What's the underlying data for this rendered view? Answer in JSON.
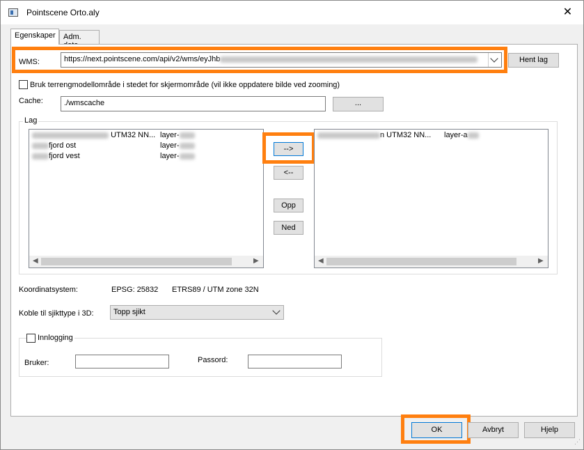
{
  "window": {
    "title": "Pointscene Orto.aly",
    "close_glyph": "✕"
  },
  "tabs": [
    {
      "label": "Egenskaper"
    },
    {
      "label": "Adm. data"
    }
  ],
  "wms": {
    "label": "WMS:",
    "value": "https://next.pointscene.com/api/v2/wms/eyJhb",
    "fetch_button": "Hent lag"
  },
  "terrain_checkbox": {
    "label": "Bruk terrengmodellområde i stedet for skjermområde (vil ikke oppdatere bilde ved zooming)",
    "checked": false
  },
  "cache": {
    "label": "Cache:",
    "value": "./wmscache",
    "browse_button": "..."
  },
  "layers": {
    "group_label": "Lag",
    "available": [
      {
        "name": "UTM32 NN...",
        "id": "layer-"
      },
      {
        "name": "fjord ost",
        "id": "layer-"
      },
      {
        "name": "fjord vest",
        "id": "layer-"
      }
    ],
    "selected": [
      {
        "name": "n  UTM32 NN...",
        "id": "layer-a"
      }
    ],
    "buttons": {
      "add": "-->",
      "remove": "<--",
      "up": "Opp",
      "down": "Ned"
    }
  },
  "coord": {
    "label": "Koordinatsystem:",
    "epsg": "EPSG: 25832",
    "name": "ETRS89 / UTM zone 32N"
  },
  "layer3d": {
    "label": "Koble til sjikttype i 3D:",
    "value": "Topp sjikt"
  },
  "login": {
    "label": "Innlogging",
    "checked": false,
    "user_label": "Bruker:",
    "user_value": "",
    "password_label": "Passord:",
    "password_value": ""
  },
  "footer": {
    "ok": "OK",
    "cancel": "Avbryt",
    "help": "Hjelp"
  },
  "colors": {
    "highlight": "#ff7f0f",
    "focus": "#0078d7"
  }
}
